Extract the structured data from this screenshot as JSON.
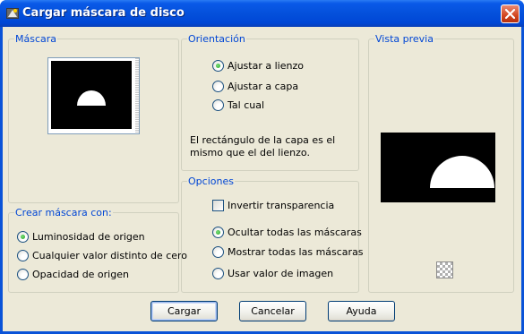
{
  "window": {
    "title": "Cargar máscara de disco",
    "close_label": "×"
  },
  "mask_group": {
    "legend": "Máscara"
  },
  "create_group": {
    "legend": "Crear máscara con:",
    "options": [
      {
        "label": "Luminosidad de origen",
        "selected": true
      },
      {
        "label": "Cualquier valor distinto de cero",
        "selected": false
      },
      {
        "label": "Opacidad de origen",
        "selected": false
      }
    ]
  },
  "orientation_group": {
    "legend": "Orientación",
    "options": [
      {
        "label": "Ajustar a lienzo",
        "selected": true
      },
      {
        "label": "Ajustar a capa",
        "selected": false
      },
      {
        "label": "Tal cual",
        "selected": false
      }
    ],
    "note": "El rectángulo de la capa es el mismo que el del lienzo."
  },
  "options_group": {
    "legend": "Opciones",
    "invert_label": "Invertir transparencia",
    "invert_checked": false,
    "options": [
      {
        "label": "Ocultar todas las máscaras",
        "selected": true
      },
      {
        "label": "Mostrar todas las máscaras",
        "selected": false
      },
      {
        "label": "Usar valor de imagen",
        "selected": false
      }
    ]
  },
  "preview_group": {
    "legend": "Vista previa"
  },
  "buttons": {
    "load": "Cargar",
    "cancel": "Cancelar",
    "help": "Ayuda"
  },
  "colors": {
    "titlebar": "#0450db",
    "legend_text": "#0046d5",
    "client_bg": "#ece9d8"
  },
  "icons": [
    "app-icon",
    "close-icon",
    "transparency-checker-icon"
  ]
}
